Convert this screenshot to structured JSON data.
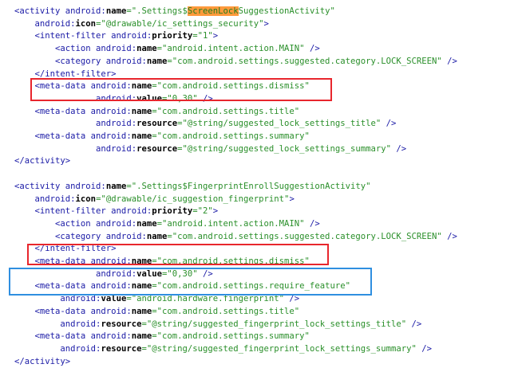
{
  "colors": {
    "tag": "#1a1aa6",
    "attribute_key": "#000000",
    "string": "#2a8f2a",
    "highlight_background": "#ff9a3c",
    "red_box": "#e8262d",
    "blue_box": "#2f8fe0"
  },
  "code_lines": [
    [
      {
        "t": "<activity android:",
        "c": "tag"
      },
      {
        "t": "name",
        "c": "key"
      },
      {
        "t": "=\".Settings$",
        "c": "val"
      },
      {
        "t": "ScreenLock",
        "c": "hl"
      },
      {
        "t": "SuggestionActivity\"",
        "c": "val"
      }
    ],
    [
      {
        "t": "    android:",
        "c": "attr"
      },
      {
        "t": "icon",
        "c": "key"
      },
      {
        "t": "=\"@drawable/ic_settings_security\"",
        "c": "val"
      },
      {
        "t": ">",
        "c": "tag"
      }
    ],
    [
      {
        "t": "    <intent-filter android:",
        "c": "tag"
      },
      {
        "t": "priority",
        "c": "key"
      },
      {
        "t": "=\"1\"",
        "c": "val"
      },
      {
        "t": ">",
        "c": "tag"
      }
    ],
    [
      {
        "t": "        <action android:",
        "c": "tag"
      },
      {
        "t": "name",
        "c": "key"
      },
      {
        "t": "=\"android.intent.action.MAIN\"",
        "c": "val"
      },
      {
        "t": " />",
        "c": "tag"
      }
    ],
    [
      {
        "t": "        <category android:",
        "c": "tag"
      },
      {
        "t": "name",
        "c": "key"
      },
      {
        "t": "=\"com.android.settings.suggested.category.LOCK_SCREEN\"",
        "c": "val"
      },
      {
        "t": " />",
        "c": "tag"
      }
    ],
    [
      {
        "t": "    </intent-filter>",
        "c": "tag"
      }
    ],
    [
      {
        "t": "    <meta-data android:",
        "c": "tag"
      },
      {
        "t": "name",
        "c": "key"
      },
      {
        "t": "=\"com.android.settings.dismiss\"",
        "c": "val"
      }
    ],
    [
      {
        "t": "                android:",
        "c": "attr"
      },
      {
        "t": "value",
        "c": "key"
      },
      {
        "t": "=\"0,30\"",
        "c": "val"
      },
      {
        "t": " />",
        "c": "tag"
      }
    ],
    [
      {
        "t": "    <meta-data android:",
        "c": "tag"
      },
      {
        "t": "name",
        "c": "key"
      },
      {
        "t": "=\"com.android.settings.title\"",
        "c": "val"
      }
    ],
    [
      {
        "t": "                android:",
        "c": "attr"
      },
      {
        "t": "resource",
        "c": "key"
      },
      {
        "t": "=\"@string/suggested_lock_settings_title\"",
        "c": "val"
      },
      {
        "t": " />",
        "c": "tag"
      }
    ],
    [
      {
        "t": "    <meta-data android:",
        "c": "tag"
      },
      {
        "t": "name",
        "c": "key"
      },
      {
        "t": "=\"com.android.settings.summary\"",
        "c": "val"
      }
    ],
    [
      {
        "t": "                android:",
        "c": "attr"
      },
      {
        "t": "resource",
        "c": "key"
      },
      {
        "t": "=\"@string/suggested_lock_settings_summary\"",
        "c": "val"
      },
      {
        "t": " />",
        "c": "tag"
      }
    ],
    [
      {
        "t": "</activity>",
        "c": "tag"
      }
    ],
    [],
    [
      {
        "t": "<activity android:",
        "c": "tag"
      },
      {
        "t": "name",
        "c": "key"
      },
      {
        "t": "=\".Settings$FingerprintEnrollSuggestionActivity\"",
        "c": "val"
      }
    ],
    [
      {
        "t": "    android:",
        "c": "attr"
      },
      {
        "t": "icon",
        "c": "key"
      },
      {
        "t": "=\"@drawable/ic_suggestion_fingerprint\"",
        "c": "val"
      },
      {
        "t": ">",
        "c": "tag"
      }
    ],
    [
      {
        "t": "    <intent-filter android:",
        "c": "tag"
      },
      {
        "t": "priority",
        "c": "key"
      },
      {
        "t": "=\"2\"",
        "c": "val"
      },
      {
        "t": ">",
        "c": "tag"
      }
    ],
    [
      {
        "t": "        <action android:",
        "c": "tag"
      },
      {
        "t": "name",
        "c": "key"
      },
      {
        "t": "=\"android.intent.action.MAIN\"",
        "c": "val"
      },
      {
        "t": " />",
        "c": "tag"
      }
    ],
    [
      {
        "t": "        <category android:",
        "c": "tag"
      },
      {
        "t": "name",
        "c": "key"
      },
      {
        "t": "=\"com.android.settings.suggested.category.LOCK_SCREEN\"",
        "c": "val"
      },
      {
        "t": " />",
        "c": "tag"
      }
    ],
    [
      {
        "t": "    </intent-filter>",
        "c": "tag"
      }
    ],
    [
      {
        "t": "    <meta-data android:",
        "c": "tag"
      },
      {
        "t": "name",
        "c": "key"
      },
      {
        "t": "=\"com.android.settings.dismiss\"",
        "c": "val"
      }
    ],
    [
      {
        "t": "                android:",
        "c": "attr"
      },
      {
        "t": "value",
        "c": "key"
      },
      {
        "t": "=\"0,30\"",
        "c": "val"
      },
      {
        "t": " />",
        "c": "tag"
      }
    ],
    [
      {
        "t": "    <meta-data android:",
        "c": "tag"
      },
      {
        "t": "name",
        "c": "key"
      },
      {
        "t": "=\"com.android.settings.require_feature\"",
        "c": "val"
      }
    ],
    [
      {
        "t": "         android:",
        "c": "attr"
      },
      {
        "t": "value",
        "c": "key"
      },
      {
        "t": "=\"android.hardware.fingerprint\"",
        "c": "val"
      },
      {
        "t": " />",
        "c": "tag"
      }
    ],
    [
      {
        "t": "    <meta-data android:",
        "c": "tag"
      },
      {
        "t": "name",
        "c": "key"
      },
      {
        "t": "=\"com.android.settings.title\"",
        "c": "val"
      }
    ],
    [
      {
        "t": "         android:",
        "c": "attr"
      },
      {
        "t": "resource",
        "c": "key"
      },
      {
        "t": "=\"@string/suggested_fingerprint_lock_settings_title\"",
        "c": "val"
      },
      {
        "t": " />",
        "c": "tag"
      }
    ],
    [
      {
        "t": "    <meta-data android:",
        "c": "tag"
      },
      {
        "t": "name",
        "c": "key"
      },
      {
        "t": "=\"com.android.settings.summary\"",
        "c": "val"
      }
    ],
    [
      {
        "t": "         android:",
        "c": "attr"
      },
      {
        "t": "resource",
        "c": "key"
      },
      {
        "t": "=\"@string/suggested_fingerprint_lock_settings_summary\"",
        "c": "val"
      },
      {
        "t": " />",
        "c": "tag"
      }
    ],
    [
      {
        "t": "</activity>",
        "c": "tag"
      }
    ]
  ]
}
